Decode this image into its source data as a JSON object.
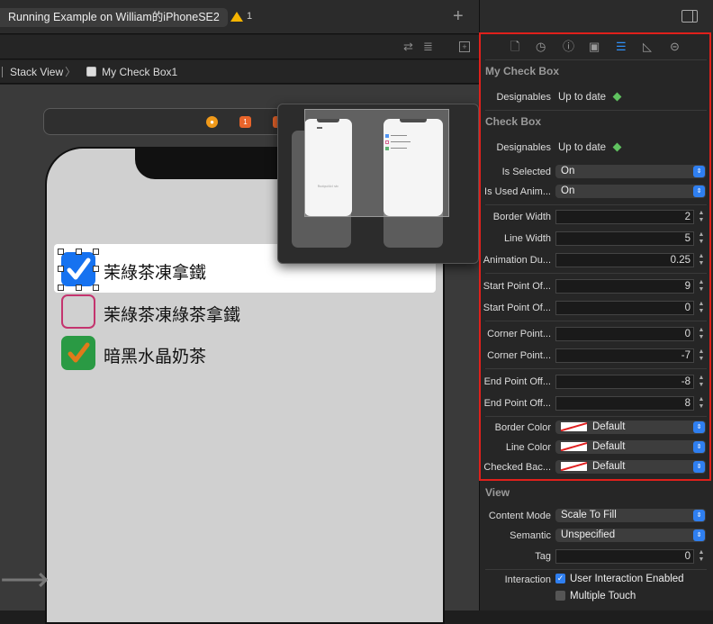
{
  "toolbar": {
    "run_tab": "Running Example on William的iPhoneSE2",
    "warning_count": "1",
    "add_tab": "+"
  },
  "jump_bar": {
    "crumb_stack_view": "Stack View",
    "separator": "〉",
    "crumb_current": "My Check Box1"
  },
  "canvas": {
    "checkboxes": [
      {
        "label": "茉綠茶凍拿鐵",
        "checked": true,
        "color": "#1672f0"
      },
      {
        "label": "茉綠茶凍綠茶拿鐵",
        "checked": false,
        "color": "#c4346e"
      },
      {
        "label": "暗黑水晶奶茶",
        "checked": true,
        "color": "#2a9a44"
      }
    ],
    "scene_icons": [
      "1"
    ],
    "popover_preview_text": "Rudgul4cl stc"
  },
  "inspector": {
    "section_my_check_box": "My Check Box",
    "section_check_box": "Check Box",
    "section_view": "View",
    "designables_label": "Designables",
    "designables_value": "Up to date",
    "is_selected_label": "Is Selected",
    "is_selected_value": "On",
    "is_used_anim_label": "Is Used Anim...",
    "is_used_anim_value": "On",
    "border_width_label": "Border Width",
    "border_width_value": "2",
    "line_width_label": "Line Width",
    "line_width_value": "5",
    "animation_du_label": "Animation Du...",
    "animation_du_value": "0.25",
    "start_point_1_label": "Start Point Of...",
    "start_point_1_value": "9",
    "start_point_2_label": "Start Point Of...",
    "start_point_2_value": "0",
    "corner_point_1_label": "Corner Point...",
    "corner_point_1_value": "0",
    "corner_point_2_label": "Corner Point...",
    "corner_point_2_value": "-7",
    "end_point_1_label": "End Point Off...",
    "end_point_1_value": "-8",
    "end_point_2_label": "End Point Off...",
    "end_point_2_value": "8",
    "border_color_label": "Border Color",
    "border_color_value": "Default",
    "line_color_label": "Line Color",
    "line_color_value": "Default",
    "checked_bac_label": "Checked Bac...",
    "checked_bac_value": "Default",
    "content_mode_label": "Content Mode",
    "content_mode_value": "Scale To Fill",
    "semantic_label": "Semantic",
    "semantic_value": "Unspecified",
    "tag_label": "Tag",
    "tag_value": "0",
    "interaction_label": "Interaction",
    "user_interaction_label": "User Interaction Enabled",
    "multiple_touch_label": "Multiple Touch"
  },
  "colors": {
    "accent": "#2f8ff7",
    "highlight_border": "#e0201b",
    "warning": "#f5b400"
  }
}
